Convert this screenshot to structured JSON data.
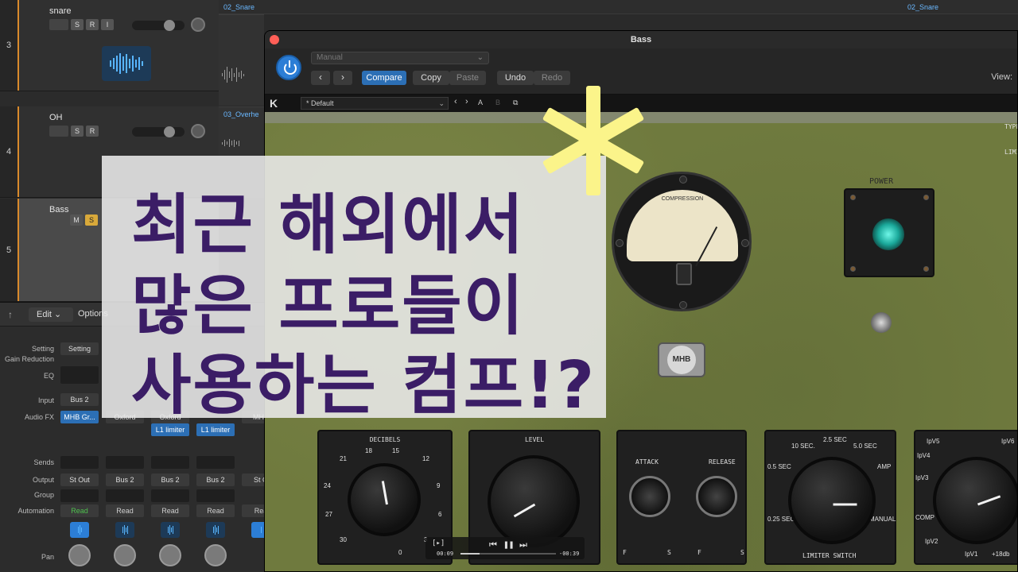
{
  "tracks": [
    {
      "num": "3",
      "name": "snare",
      "buttons": [
        "S",
        "R",
        "I"
      ]
    },
    {
      "num": "4",
      "name": "OH",
      "buttons": [
        "S",
        "R"
      ]
    },
    {
      "num": "5",
      "name": "Bass",
      "buttons": [
        "M",
        "S"
      ]
    }
  ],
  "timeline": {
    "region1": "02_Snare",
    "region2": "02_Snare",
    "region3": "03_Overhe"
  },
  "mixer": {
    "back_icon": "back-arrow-icon",
    "edit_label": "Edit",
    "options_label": "Options",
    "row_labels": [
      "Setting",
      "Gain Reduction",
      "EQ",
      "Input",
      "Audio FX",
      "Sends",
      "Output",
      "Group",
      "Automation",
      "Pan"
    ],
    "setting_btn": "Setting",
    "input_value": "Bus 2",
    "audio_fx": [
      "MHB Gr...",
      "Oxford",
      "Oxford",
      "MHB"
    ],
    "limiter": [
      "L1 limiter",
      "L1 limiter"
    ],
    "outputs": [
      "St Out",
      "Bus 2",
      "Bus 2",
      "Bus 2",
      "St O"
    ],
    "automation": [
      "Read",
      "Read",
      "Read",
      "Read",
      "Rea"
    ]
  },
  "plugin": {
    "title": "Bass",
    "preset_placeholder": "Manual",
    "compare": "Compare",
    "copy": "Copy",
    "paste": "Paste",
    "undo": "Undo",
    "redo": "Redo",
    "view_label": "View:",
    "kbar_logo": "K",
    "kbar_preset": "* Default",
    "kbar_a": "A",
    "kbar_b": "B",
    "panel": {
      "vu_label": "COMPRESSION",
      "power_label": "POWER",
      "badge_text": "MHB",
      "decibels_label": "DECIBELS",
      "level_label": "LEVEL",
      "attack_label": "ATTACK",
      "release_label": "RELEASE",
      "limiter_switch_label": "LIMITER SWITCH",
      "type_label": "TYPE",
      "limit_label": "LIMI",
      "decibels_ticks": [
        "21",
        "18",
        "15",
        "12",
        "9",
        "6",
        "3",
        "0",
        "30",
        "27",
        "24"
      ],
      "switch_ticks": [
        "10 SEC.",
        "2.5 SEC",
        "5.0 SEC",
        "0.5 SEC",
        "AMP",
        "0.25 SEC.",
        "MANUAL"
      ],
      "ipv_ticks": [
        "IpV5",
        "IpV4",
        "IpV6",
        "IpV3",
        "COMP",
        "IpV2",
        "IpV1",
        "+18db"
      ]
    },
    "transport": {
      "time_left": "00:09",
      "time_right": "-00:39"
    }
  },
  "overlay": {
    "line1": "최근 해외에서",
    "line2": "많은 프로들이",
    "line3": "사용하는 컴프!?"
  },
  "colors": {
    "accent_blue": "#2c6fb5",
    "headline": "#3b1d66",
    "asterisk": "#fbf48a",
    "panel_green": "#6f7a3e",
    "led": "#1aa89a"
  }
}
